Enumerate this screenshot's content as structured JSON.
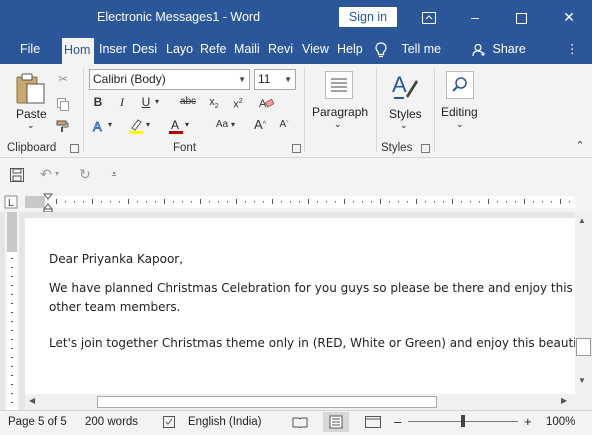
{
  "window": {
    "title": "Electronic Messages1  -  Word",
    "signin_label": "Sign in"
  },
  "tabs": [
    {
      "label": "File"
    },
    {
      "label": "Hom"
    },
    {
      "label": "Inser"
    },
    {
      "label": "Desi"
    },
    {
      "label": "Layo"
    },
    {
      "label": "Refe"
    },
    {
      "label": "Maili"
    },
    {
      "label": "Revi"
    },
    {
      "label": "View"
    },
    {
      "label": "Help"
    }
  ],
  "tell_me": "Tell me",
  "share": "Share",
  "ribbon": {
    "paste_label": "Paste",
    "clipboard_label": "Clipboard",
    "font_name": "Calibri (Body)",
    "font_size": "11",
    "font_label": "Font",
    "paragraph_label": "Paragraph",
    "styles_label": "Styles",
    "styles_group_label": "Styles",
    "editing_label": "Editing"
  },
  "document": {
    "line1": "Dear Priyanka Kapoor,",
    "line2": "We have planned Christmas Celebration for you guys so please be there and enjoy this mom",
    "line3": "other team members.",
    "line4": "Let's join together Christmas theme only in (RED, White or Green) and enjoy this beautiful Da"
  },
  "status": {
    "page": "Page 5 of 5",
    "words": "200 words",
    "language": "English (India)",
    "zoom": "100%"
  },
  "colors": {
    "brand": "#2b579a",
    "font_color": "#c00000",
    "highlight": "#ffff00"
  }
}
